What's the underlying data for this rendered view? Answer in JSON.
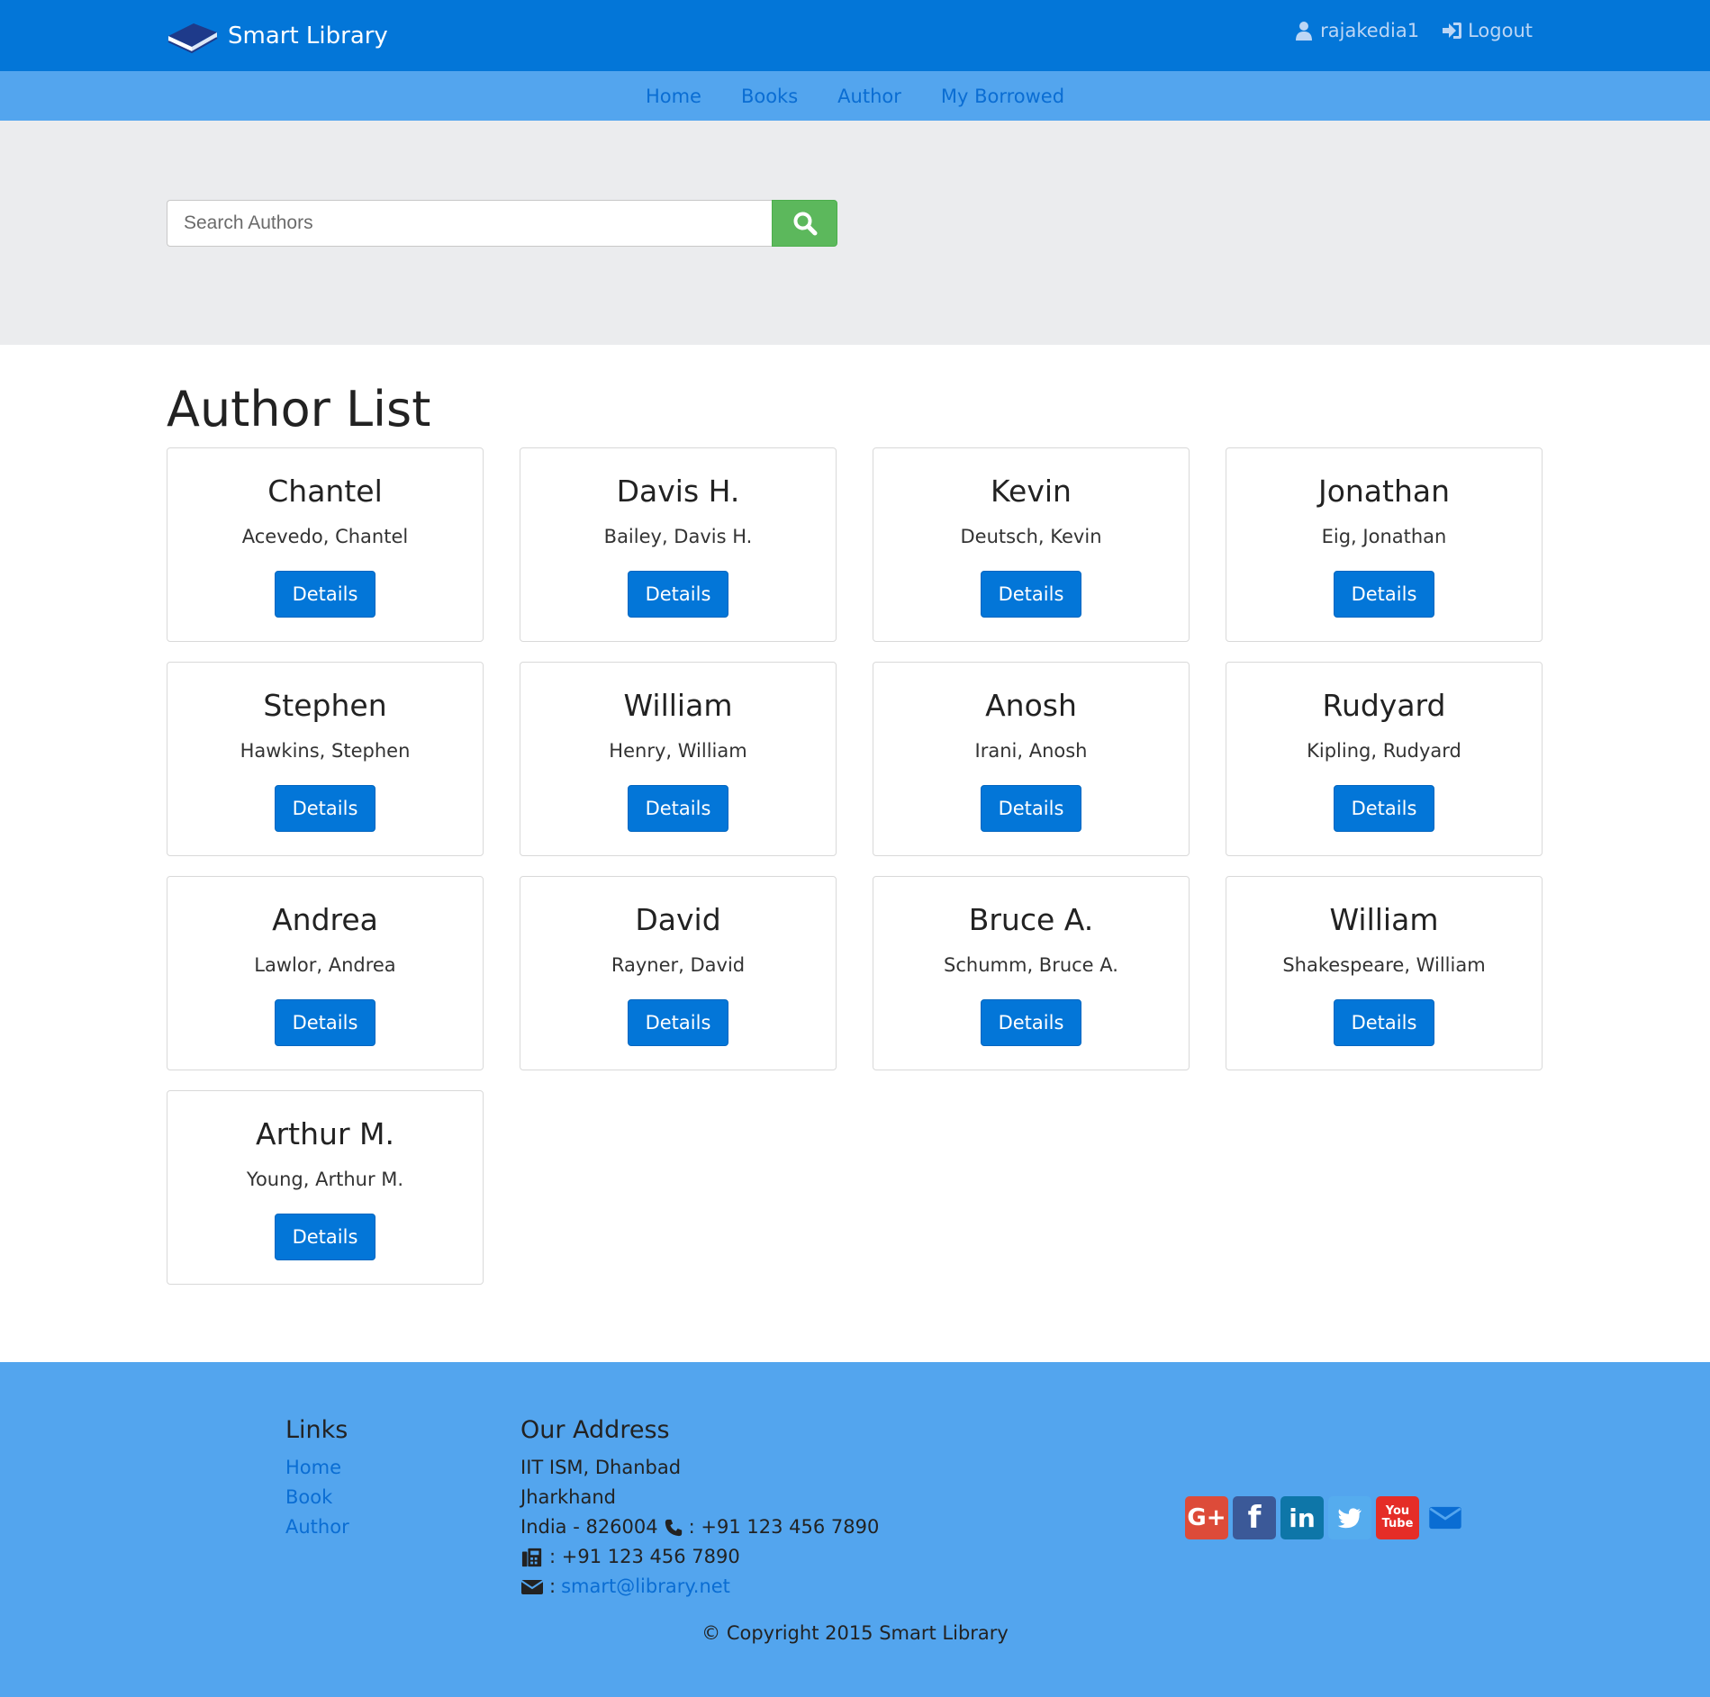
{
  "header": {
    "brand": "Smart Library",
    "username": "rajakedia1",
    "logout_label": "Logout"
  },
  "nav": {
    "items": [
      "Home",
      "Books",
      "Author",
      "My Borrowed"
    ]
  },
  "search": {
    "placeholder": "Search Authors"
  },
  "main": {
    "title": "Author List",
    "button_label": "Details",
    "authors": [
      {
        "first": "Chantel",
        "full": "Acevedo, Chantel"
      },
      {
        "first": "Davis H.",
        "full": "Bailey, Davis H."
      },
      {
        "first": "Kevin",
        "full": "Deutsch, Kevin"
      },
      {
        "first": "Jonathan",
        "full": "Eig, Jonathan"
      },
      {
        "first": "Stephen",
        "full": "Hawkins, Stephen"
      },
      {
        "first": "William",
        "full": "Henry, William"
      },
      {
        "first": "Anosh",
        "full": "Irani, Anosh"
      },
      {
        "first": "Rudyard",
        "full": "Kipling, Rudyard"
      },
      {
        "first": "Andrea",
        "full": "Lawlor, Andrea"
      },
      {
        "first": "David",
        "full": "Rayner, David"
      },
      {
        "first": "Bruce A.",
        "full": "Schumm, Bruce A."
      },
      {
        "first": "William",
        "full": "Shakespeare, William"
      },
      {
        "first": "Arthur M.",
        "full": "Young, Arthur M."
      }
    ]
  },
  "footer": {
    "links_title": "Links",
    "links": [
      "Home",
      "Book",
      "Author"
    ],
    "address_title": "Our Address",
    "address_line1": "IIT ISM, Dhanbad",
    "address_line2": "Jharkhand",
    "address_line3": "India - 826004",
    "phone": ": +91 123 456 7890",
    "fax": ": +91 123 456 7890",
    "email_prefix": ":",
    "email": "smart@library.net",
    "copyright": "© Copyright 2015 Smart Library",
    "social": [
      "google-plus-icon",
      "facebook-icon",
      "linkedin-icon",
      "twitter-icon",
      "youtube-icon",
      "envelope-icon"
    ]
  },
  "colors": {
    "header_bg": "#0376d8",
    "subnav_bg": "#53a5ee",
    "jumbo_bg": "#ebecee",
    "search_btn": "#5cb85c",
    "primary_btn": "#0376d8",
    "footer_bg": "#53a5ee"
  }
}
